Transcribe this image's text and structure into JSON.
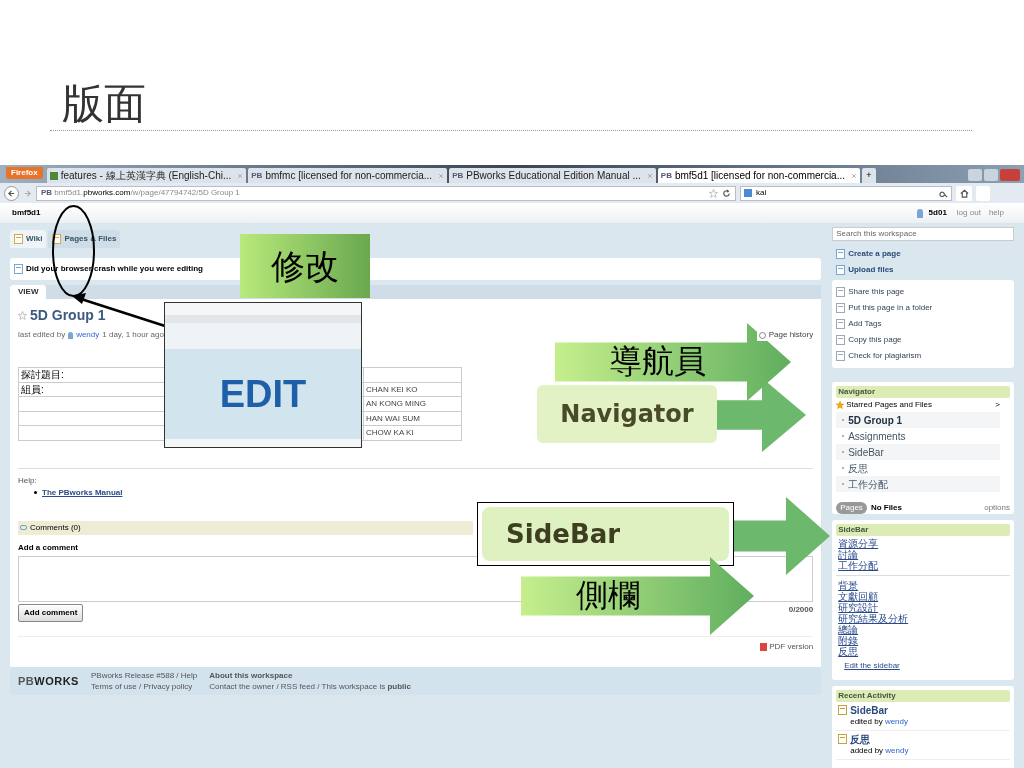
{
  "slide": {
    "title": "版面"
  },
  "browser": {
    "menu_button": "Firefox",
    "tabs": [
      {
        "label": "features - 線上英漢字典 (English-Chi...",
        "selected": false
      },
      {
        "label": "bmfmc [licensed for non-commercia...",
        "badge": "PB",
        "selected": false
      },
      {
        "label": "PBworks Educational Edition Manual ...",
        "badge": "PB",
        "selected": false
      },
      {
        "label": "bmf5d1 [licensed for non-commercia...",
        "badge": "PB",
        "selected": true
      }
    ],
    "new_tab": "+",
    "url_badge": "PB",
    "url_prefix": "bmf5d1.",
    "url_domain": "pbworks.com",
    "url_path": "/w/page/47794742/5D Group 1",
    "search_value": "kai"
  },
  "workspace": {
    "name": "bmf5d1",
    "user": "5d01",
    "links": [
      "log out",
      "help"
    ],
    "tabs": [
      {
        "label": "Wiki",
        "selected": true
      },
      {
        "label": "Pages & Files",
        "selected": false
      }
    ],
    "search_placeholder": "Search this workspace"
  },
  "notice": {
    "text": "Did your browser crash while you were editing"
  },
  "page": {
    "view_tabs": [
      {
        "label": "VIEW",
        "selected": true
      }
    ],
    "title": "5D Group 1",
    "meta_prefix": "last edited by",
    "meta_user": "wendy",
    "meta_time": "1 day, 1 hour ago",
    "history": "Page history",
    "table": [
      {
        "label": "探討題目:"
      },
      {
        "label": "組員:",
        "member": "CHAN KEI KO"
      },
      {
        "member": "AN KONG MING"
      },
      {
        "member": "HAN WAI SUM"
      },
      {
        "member": "CHOW KA KI"
      }
    ],
    "help_label": "Help:",
    "help_link": "The PBworks Manual",
    "comments": "Comments (0)",
    "add_comment_label": "Add a comment",
    "add_comment_button": "Add comment",
    "counter": "0/2000",
    "pdf": "PDF version"
  },
  "footer": {
    "logo_light": "PB",
    "logo_bold": "WORKS",
    "release": "PBworks Release #588 / Help",
    "terms": "Terms of use / Privacy policy",
    "about": "About this workspace",
    "contact": "Contact the owner / RSS feed / This workspace is **public**"
  },
  "sidebar": {
    "create": "Create a page",
    "upload": "Upload files",
    "actions": [
      "Share this page",
      "Put this page in a folder",
      "Add Tags",
      "Copy this page",
      "Check for plagiarism"
    ],
    "navigator": {
      "title": "Navigator",
      "starred": "Starred Pages and Files",
      "chevron": ">",
      "items": [
        {
          "label": "5D Group 1",
          "selected": true
        },
        {
          "label": "Assignments",
          "selected": false
        },
        {
          "label": "SideBar",
          "selected": false
        },
        {
          "label": "反思",
          "selected": false
        },
        {
          "label": "工作分配",
          "selected": false
        }
      ],
      "pages_button": "Pages",
      "files": "No Files",
      "options": "options"
    },
    "sidebar_widget": {
      "title": "SideBar",
      "group_1": [
        "資源分享",
        "討論",
        "工作分配"
      ],
      "group_2": [
        "背景",
        "文獻回顧",
        "研究設計",
        "研究結果及分析",
        "總論",
        "附錄",
        "反思"
      ],
      "edit": "Edit the sidebar"
    },
    "recent": {
      "title": "Recent Activity",
      "items": [
        {
          "title": "SideBar",
          "action": "edited by",
          "user": "wendy"
        },
        {
          "title": "反思",
          "action": "added by",
          "user": "wendy"
        }
      ]
    }
  },
  "callouts": [
    {
      "kind": "label",
      "text": "修改"
    },
    {
      "kind": "zoom",
      "text": "EDIT"
    },
    {
      "kind": "arrow",
      "text": "導航員"
    },
    {
      "kind": "badge",
      "text": "Navigator"
    },
    {
      "kind": "framed",
      "text": "SideBar"
    },
    {
      "kind": "arrow",
      "text": "側欄"
    }
  ]
}
